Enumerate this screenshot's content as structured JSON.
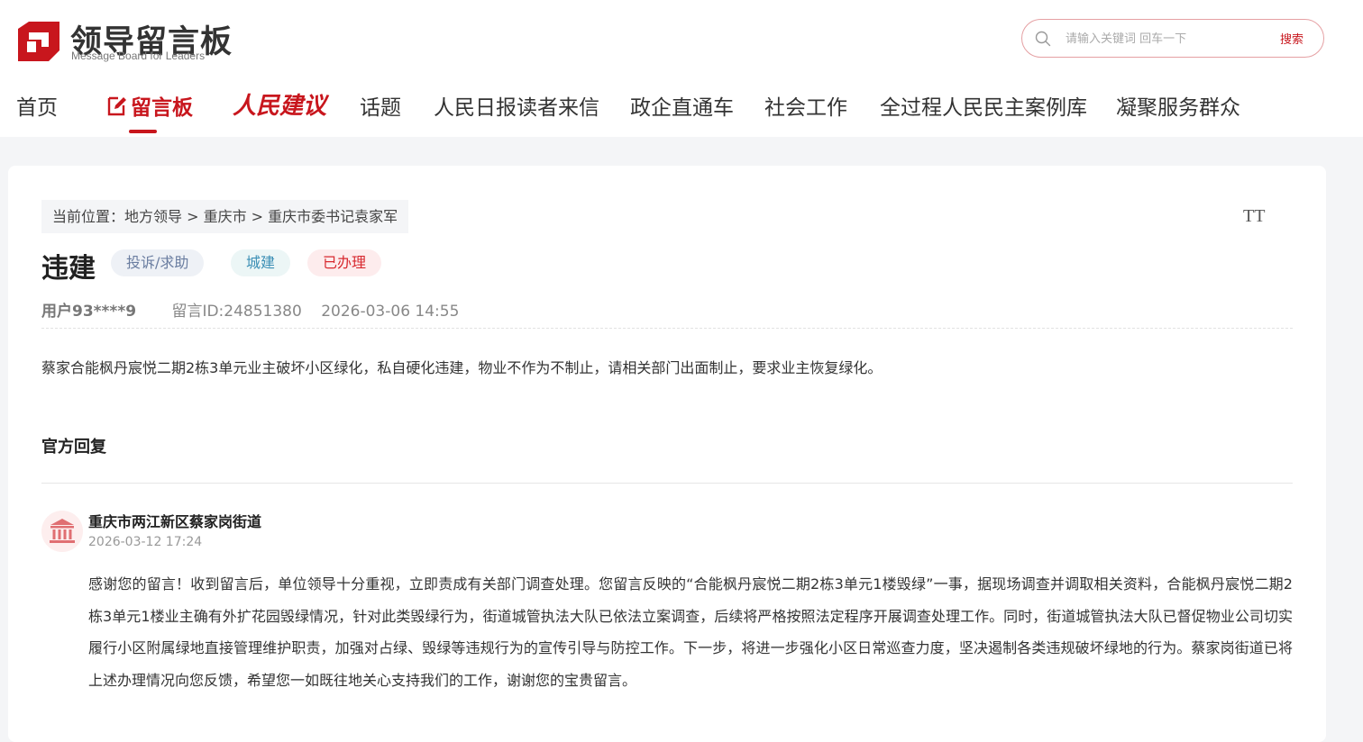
{
  "logo": {
    "cn": "领导留言板",
    "en": "Message Board for Leaders"
  },
  "search": {
    "placeholder": "请输入关键词 回车一下",
    "button": "搜索"
  },
  "nav": {
    "items": [
      "首页",
      "留言板",
      "人民建议",
      "话题",
      "人民日报读者来信",
      "政企直通车",
      "社会工作",
      "全过程人民民主案例库",
      "凝聚服务群众"
    ],
    "active": "留言板"
  },
  "icons": {
    "logo": "logo-mark-icon",
    "search": "search-icon",
    "edit": "edit-icon",
    "font_size": "font-size-icon",
    "avatar": "government-building-icon"
  },
  "colors": {
    "brand": "#c8161d",
    "tag_complaint": "#6a7da0",
    "tag_category": "#3b8fb5",
    "tag_status": "#d8292f"
  },
  "breadcrumb": "当前位置：地方领导 > 重庆市 > 重庆市委书记袁家军",
  "font_size_icon_text": "TT",
  "message": {
    "title": "违建",
    "tags": [
      "投诉/求助",
      "城建",
      "已办理"
    ],
    "user": "用户93****9",
    "id": "留言ID:24851380",
    "time": "2026-03-06 14:55",
    "content": "蔡家合能枫丹宸悦二期2栋3单元业主破坏小区绿化，私自硬化违建，物业不作为不制止，请相关部门出面制止，要求业主恢复绿化。"
  },
  "reply": {
    "heading": "官方回复",
    "org": "重庆市两江新区蔡家岗街道",
    "time": "2026-03-12 17:24",
    "text": "感谢您的留言！收到留言后，单位领导十分重视，立即责成有关部门调查处理。您留言反映的“合能枫丹宸悦二期2栋3单元1楼毁绿”一事，据现场调查并调取相关资料，合能枫丹宸悦二期2栋3单元1楼业主确有外扩花园毁绿情况，针对此类毁绿行为，街道城管执法大队已依法立案调查，后续将严格按照法定程序开展调查处理工作。同时，街道城管执法大队已督促物业公司切实履行小区附属绿地直接管理维护职责，加强对占绿、毁绿等违规行为的宣传引导与防控工作。下一步，将进一步强化小区日常巡查力度，坚决遏制各类违规破坏绿地的行为。蔡家岗街道已将上述办理情况向您反馈，希望您一如既往地关心支持我们的工作，谢谢您的宝贵留言。"
  }
}
